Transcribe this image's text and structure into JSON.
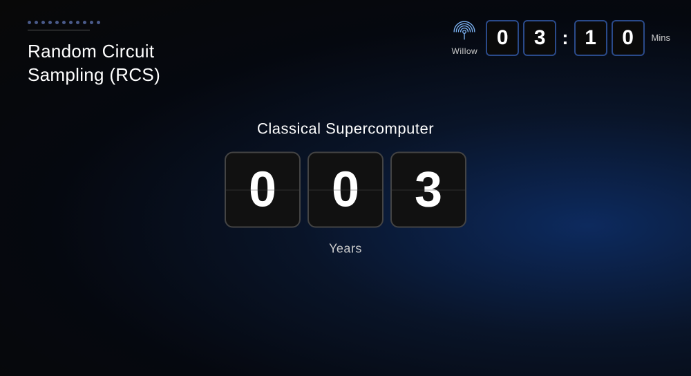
{
  "background": {
    "color_left": "#0a0a0f",
    "color_right": "#0d2a5e"
  },
  "top_left": {
    "dots_count": 11,
    "dot_color": "#4a5a8a",
    "title_line1": "Random Circuit",
    "title_line2": "Sampling (RCS)"
  },
  "top_right": {
    "willow_label": "Willow",
    "timer": {
      "digit1": "0",
      "digit2": "3",
      "colon": ":",
      "digit3": "1",
      "digit4": "0",
      "unit": "Mins"
    }
  },
  "center": {
    "subtitle": "Classical Supercomputer",
    "flip_digits": [
      "0",
      "0",
      "3"
    ],
    "unit_label": "Years"
  }
}
